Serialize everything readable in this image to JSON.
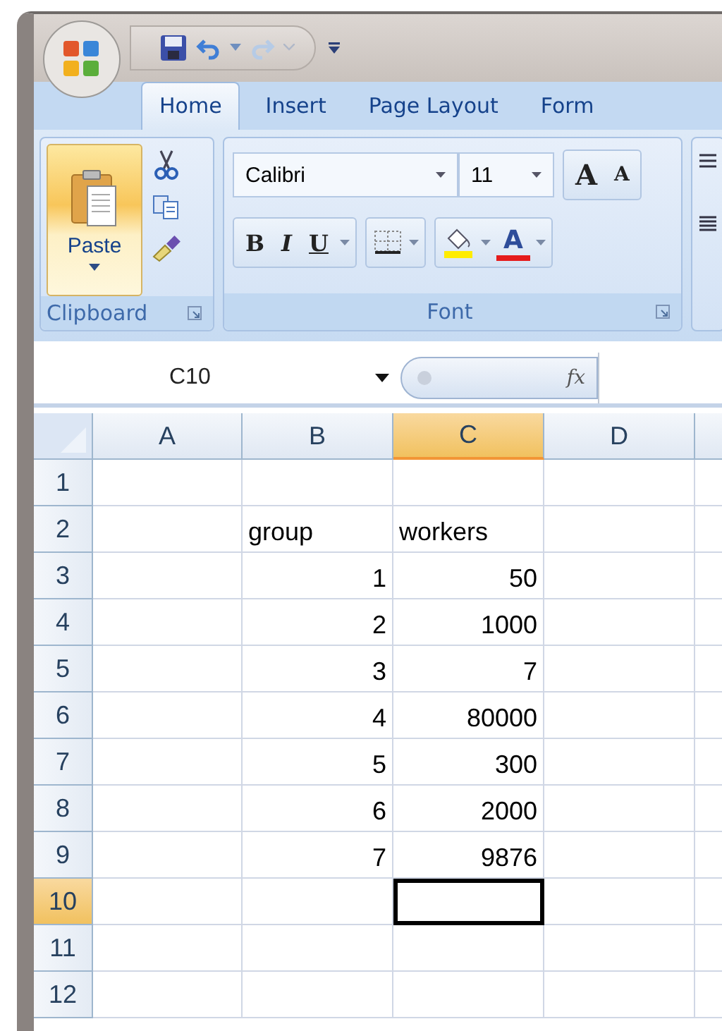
{
  "tabs": [
    {
      "label": "Home",
      "selected": true
    },
    {
      "label": "Insert",
      "selected": false
    },
    {
      "label": "Page Layout",
      "selected": false
    },
    {
      "label": "Form",
      "selected": false
    }
  ],
  "clipboard": {
    "paste_label": "Paste",
    "group_label": "Clipboard"
  },
  "font": {
    "name": "Calibri",
    "size": "11",
    "grow": "A",
    "shrink": "A",
    "bold": "B",
    "italic": "I",
    "underline": "U",
    "font_color": "A",
    "group_label": "Font"
  },
  "formula_bar": {
    "name_box": "C10",
    "function_label": "fx"
  },
  "columns": [
    {
      "label": "A",
      "selected": false
    },
    {
      "label": "B",
      "selected": false
    },
    {
      "label": "C",
      "selected": true
    },
    {
      "label": "D",
      "selected": false
    }
  ],
  "rows": [
    {
      "header": "1",
      "selected": false,
      "cells": [
        {
          "selected": false
        },
        {
          "selected": false
        },
        {
          "selected": false
        },
        {
          "selected": false
        }
      ]
    },
    {
      "header": "2",
      "selected": false,
      "cells": [
        {
          "selected": false
        },
        {
          "selected": false,
          "kind": "text",
          "text": "group"
        },
        {
          "selected": false,
          "kind": "text",
          "text": "workers"
        },
        {
          "selected": false
        }
      ]
    },
    {
      "header": "3",
      "selected": false,
      "cells": [
        {
          "selected": false
        },
        {
          "selected": false,
          "kind": "number",
          "text": "1"
        },
        {
          "selected": false,
          "kind": "number",
          "text": "50"
        },
        {
          "selected": false
        }
      ]
    },
    {
      "header": "4",
      "selected": false,
      "cells": [
        {
          "selected": false
        },
        {
          "selected": false,
          "kind": "number",
          "text": "2"
        },
        {
          "selected": false,
          "kind": "number",
          "text": "1000"
        },
        {
          "selected": false
        }
      ]
    },
    {
      "header": "5",
      "selected": false,
      "cells": [
        {
          "selected": false
        },
        {
          "selected": false,
          "kind": "number",
          "text": "3"
        },
        {
          "selected": false,
          "kind": "number",
          "text": "7"
        },
        {
          "selected": false
        }
      ]
    },
    {
      "header": "6",
      "selected": false,
      "cells": [
        {
          "selected": false
        },
        {
          "selected": false,
          "kind": "number",
          "text": "4"
        },
        {
          "selected": false,
          "kind": "number",
          "text": "80000"
        },
        {
          "selected": false
        }
      ]
    },
    {
      "header": "7",
      "selected": false,
      "cells": [
        {
          "selected": false
        },
        {
          "selected": false,
          "kind": "number",
          "text": "5"
        },
        {
          "selected": false,
          "kind": "number",
          "text": "300"
        },
        {
          "selected": false
        }
      ]
    },
    {
      "header": "8",
      "selected": false,
      "cells": [
        {
          "selected": false
        },
        {
          "selected": false,
          "kind": "number",
          "text": "6"
        },
        {
          "selected": false,
          "kind": "number",
          "text": "2000"
        },
        {
          "selected": false
        }
      ]
    },
    {
      "header": "9",
      "selected": false,
      "cells": [
        {
          "selected": false
        },
        {
          "selected": false,
          "kind": "number",
          "text": "7"
        },
        {
          "selected": false,
          "kind": "number",
          "text": "9876"
        },
        {
          "selected": false
        }
      ]
    },
    {
      "header": "10",
      "selected": true,
      "cells": [
        {
          "selected": false
        },
        {
          "selected": false
        },
        {
          "selected": true
        },
        {
          "selected": false
        }
      ]
    },
    {
      "header": "11",
      "selected": false,
      "cells": [
        {
          "selected": false
        },
        {
          "selected": false
        },
        {
          "selected": false
        },
        {
          "selected": false
        }
      ]
    },
    {
      "header": "12",
      "selected": false,
      "cells": [
        {
          "selected": false
        },
        {
          "selected": false
        },
        {
          "selected": false
        },
        {
          "selected": false
        }
      ]
    }
  ]
}
